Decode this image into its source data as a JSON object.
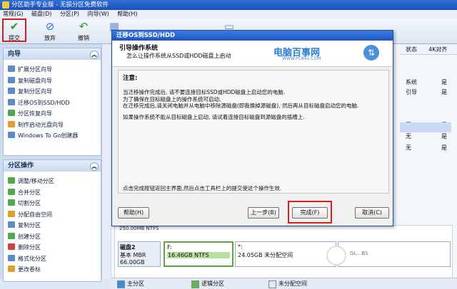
{
  "titlebar": {
    "title": "分区助手专业版 - 无损分区免费软件"
  },
  "menubar": {
    "items": [
      "常规(G)",
      "磁盘(D)",
      "分区(P)",
      "向导(W)",
      "帮助(H)"
    ]
  },
  "toolbar": {
    "commit": "提交",
    "discard": "放弃",
    "undo": "撤销"
  },
  "sidebar": {
    "wizard_title": "向导",
    "wizard_items": [
      "扩展分区向导",
      "复制磁盘向导",
      "复制分区向导",
      "迁移OS到SSD/HDD",
      "分区恢复向导",
      "制作启动光盘向导",
      "Windows To Go创建器"
    ],
    "ops_title": "分区操作",
    "ops_items": [
      "调整/移动分区",
      "合并分区",
      "切割分区",
      "分配自由空间",
      "复制分区",
      "创建分区",
      "删除分区",
      "格式化分区",
      "更改卷标"
    ]
  },
  "columns": {
    "status": "状态",
    "flag": "4K对齐"
  },
  "rows": [
    {
      "status": "系统",
      "flag": "是"
    },
    {
      "status": "引导",
      "flag": "是"
    },
    {
      "status": "无",
      "flag": "是"
    },
    {
      "status": "无",
      "flag": "是"
    },
    {
      "status": "无",
      "flag": "是"
    }
  ],
  "dialog": {
    "title": "迁移OS到SSD/HDD",
    "heading": "引导操作系统",
    "subheading": "怎么让操作系统从SSD或HDD磁盘上启动",
    "watermark": "电脑百事网",
    "watermark_url": "WWW.PC841.COM",
    "note_label": "注意:",
    "para1_l1": "当迁移操作完成后, 请不要连接目标SSD或HDD磁盘上启动您的电脑.",
    "para1_l2": "为了确保在目标磁盘上的操作系统可启动,",
    "para1_l3": "在迁移完成后,请关闭电脑并从电脑中移除源磁盘(即我换掉源磁盘), 然后再从目标磁盘启动您的电脑.",
    "para2": "如果操作系统不能从目标磁盘上启动, 请试着连接目标磁盘到源磁盘的插槽上.",
    "footer": "点击完成按钮返回主界面,然后点击工具栏上的提交使这个操作生效.",
    "btn_help": "帮助(H)",
    "btn_back": "上一步(B)",
    "btn_finish": "完成(F)",
    "btn_cancel": "取消(C)"
  },
  "disk": {
    "top_label": "250.00MB NTFS",
    "name": "磁盘2",
    "type": "基本 MBR",
    "size": "66.00GB",
    "p1_letter": "F:",
    "p1_info": "16.46GB NTFS",
    "p2_letter": "*:",
    "p2_info": "24.05GB 未分配空间",
    "p3_info": "GL…BS"
  },
  "legend": {
    "primary": "主分区",
    "logical": "逻辑分区",
    "unalloc": "未分配空间"
  },
  "colors": {
    "accent": "#1e55c0",
    "highlight": "#d62020",
    "green": "#4caa4c"
  }
}
